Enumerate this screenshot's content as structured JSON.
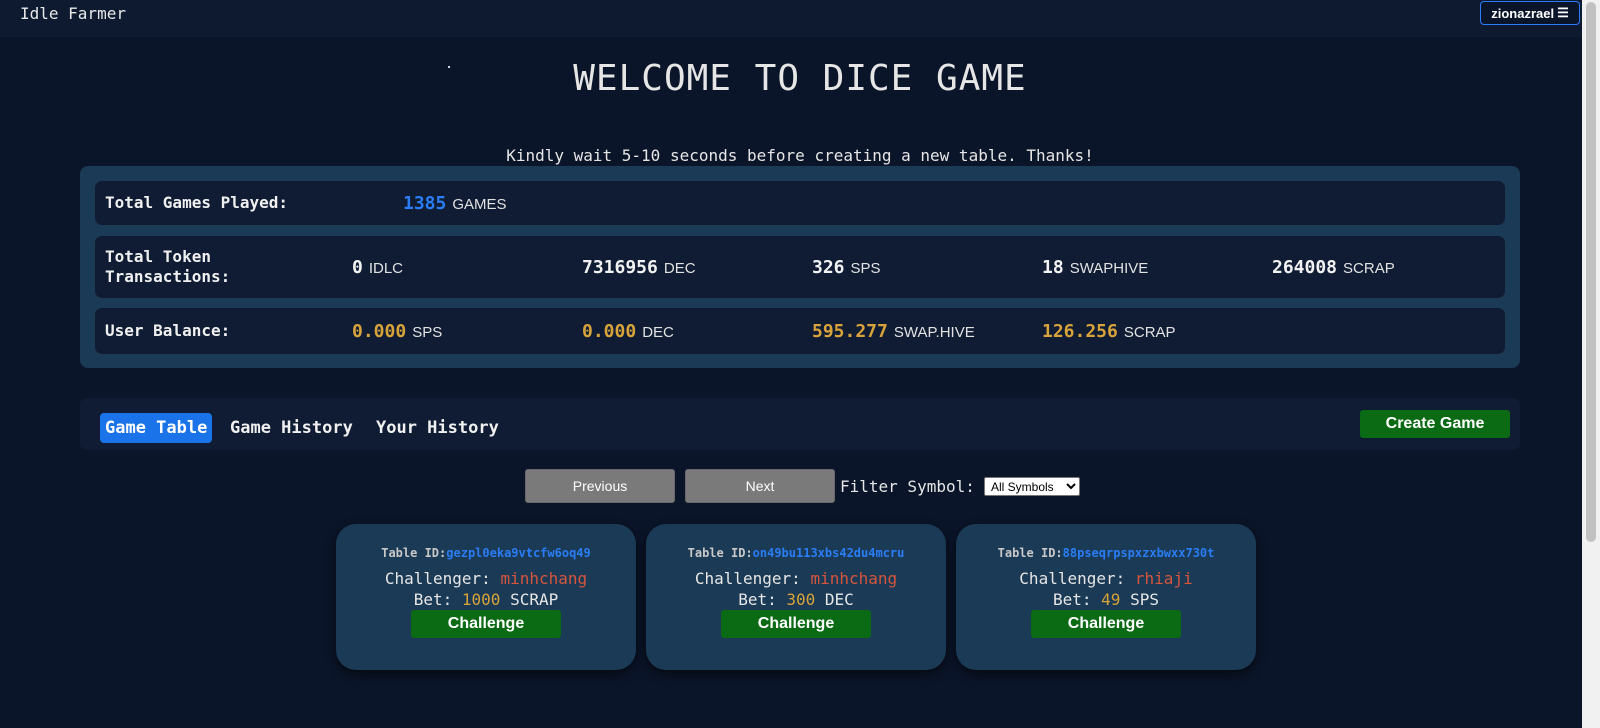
{
  "header": {
    "brand": "Idle Farmer",
    "user": "zionazrael",
    "menu_glyph": "☰"
  },
  "main": {
    "title": "WELCOME TO DICE GAME",
    "notice": "Kindly wait 5-10 seconds before creating a new table. Thanks!"
  },
  "stats": {
    "games_played": {
      "label": "Total Games Played:",
      "value": "1385",
      "unit": "GAMES"
    },
    "token_transactions": {
      "label": "Total Token Transactions:",
      "items": [
        {
          "value": "0",
          "unit": "IDLC"
        },
        {
          "value": "7316956",
          "unit": "DEC"
        },
        {
          "value": "326",
          "unit": "SPS"
        },
        {
          "value": "18",
          "unit": "SWAPHIVE"
        },
        {
          "value": "264008",
          "unit": "SCRAP"
        }
      ]
    },
    "user_balance": {
      "label": "User Balance:",
      "items": [
        {
          "value": "0.000",
          "unit": "SPS"
        },
        {
          "value": "0.000",
          "unit": "DEC"
        },
        {
          "value": "595.277",
          "unit": "SWAP.HIVE"
        },
        {
          "value": "126.256",
          "unit": "SCRAP"
        }
      ]
    }
  },
  "tabs": [
    {
      "label": "Game Table",
      "active": true
    },
    {
      "label": "Game History",
      "active": false
    },
    {
      "label": "Your History",
      "active": false
    }
  ],
  "create_game_label": "Create Game",
  "pager": {
    "previous": "Previous",
    "next": "Next"
  },
  "filter": {
    "label": "Filter Symbol:",
    "selected": "All Symbols"
  },
  "tables": [
    {
      "id_label": "Table ID:",
      "id": "gezpl0eka9vtcfw6oq49",
      "challenger_label": "Challenger:",
      "challenger": "minhchang",
      "bet_label": "Bet:",
      "bet_amount": "1000",
      "bet_symbol": "SCRAP",
      "button": "Challenge"
    },
    {
      "id_label": "Table ID:",
      "id": "on49bu113xbs42du4mcru",
      "challenger_label": "Challenger:",
      "challenger": "minhchang",
      "bet_label": "Bet:",
      "bet_amount": "300",
      "bet_symbol": "DEC",
      "button": "Challenge"
    },
    {
      "id_label": "Table ID:",
      "id": "88pseqrpspxzxbwxx730t",
      "challenger_label": "Challenger:",
      "challenger": "rhiaji",
      "bet_label": "Bet:",
      "bet_amount": "49",
      "bet_symbol": "SPS",
      "button": "Challenge"
    }
  ],
  "colors": {
    "background": "#0b1529",
    "panel": "#1b3a55",
    "row": "#0f1c33",
    "accent_blue": "#1a73e8",
    "gold": "#d8a33a",
    "green_button": "#0b6b14",
    "name_red": "#d5553d"
  }
}
